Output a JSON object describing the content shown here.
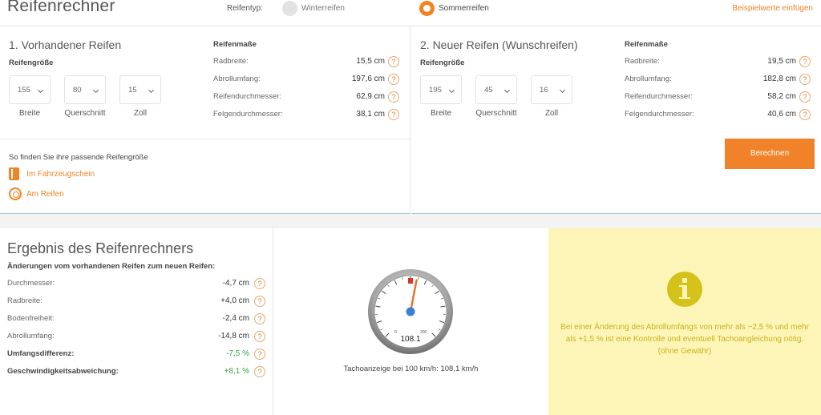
{
  "header": {
    "title": "Reifenrechner",
    "type_label": "Reifentyp:",
    "winter_label": "Winterreifen",
    "sommer_label": "Sommerreifen",
    "selected_type": "Sommerreifen",
    "example_link": "Beispielwerte einfügen"
  },
  "existing": {
    "title": "1. Vorhandener Reifen",
    "size_label": "Reifengröße",
    "selects": [
      {
        "value": "155",
        "caption": "Breite"
      },
      {
        "value": "80",
        "caption": "Querschnitt"
      },
      {
        "value": "15",
        "caption": "Zoll"
      }
    ],
    "dims_heading": "Reifenmaße",
    "dims": [
      {
        "label": "Radbreite:",
        "value": "15,5 cm"
      },
      {
        "label": "Abrollumfang:",
        "value": "197,6 cm"
      },
      {
        "label": "Reifendurchmesser:",
        "value": "62,9 cm"
      },
      {
        "label": "Felgendurchmesser:",
        "value": "38,1 cm"
      }
    ],
    "find_heading": "So finden Sie ihre passende Reifengröße",
    "find_links": [
      "Im Fahrzeugschein",
      "Am Reifen"
    ]
  },
  "new": {
    "title": "2. Neuer Reifen (Wunschreifen)",
    "size_label": "Reifengröße",
    "selects": [
      {
        "value": "195",
        "caption": "Breite"
      },
      {
        "value": "45",
        "caption": "Querschnitt"
      },
      {
        "value": "16",
        "caption": "Zoll"
      }
    ],
    "dims_heading": "Reifenmaße",
    "dims": [
      {
        "label": "Radbreite:",
        "value": "19,5 cm"
      },
      {
        "label": "Abrollumfang:",
        "value": "182,8 cm"
      },
      {
        "label": "Reifendurchmesser:",
        "value": "58,2 cm"
      },
      {
        "label": "Felgendurchmesser:",
        "value": "40,6 cm"
      }
    ],
    "calc_button": "Berechnen"
  },
  "result": {
    "title": "Ergebnis des Reifenrechners",
    "subtitle": "Änderungen vom vorhandenen Reifen zum neuen Reifen:",
    "rows": [
      {
        "label": "Durchmesser:",
        "value": "-4,7 cm"
      },
      {
        "label": "Radbreite:",
        "value": "+4,0 cm"
      },
      {
        "label": "Bodenfreiheit:",
        "value": "-2,4 cm"
      },
      {
        "label": "Abrollumfang:",
        "value": "-14,8 cm"
      },
      {
        "label": "Umfangsdifferenz:",
        "value": "-7,5 %"
      },
      {
        "label": "Geschwindigkeitsabweichung:",
        "value": "+8,1 %"
      }
    ],
    "help_glyph": "?"
  },
  "gauge": {
    "reading": "108.1",
    "min_label": "0",
    "max_label": "200",
    "value": 108.1,
    "max": 200,
    "caption": "Tachoanzeige bei 100 km/h: 108,1 km/h",
    "needle_color": "#e8702a",
    "marker_color": "#d9362a",
    "hub_color": "#3b7fd4"
  },
  "info": {
    "icon": "info-icon",
    "text": "Bei einer Änderung des Abrollumfangs von mehr als −2,5 % und mehr als +1,5 % ist eine Kontrolle und eventuell Tachoangleichung nötig.",
    "note": "(ohne Gewähr)"
  }
}
